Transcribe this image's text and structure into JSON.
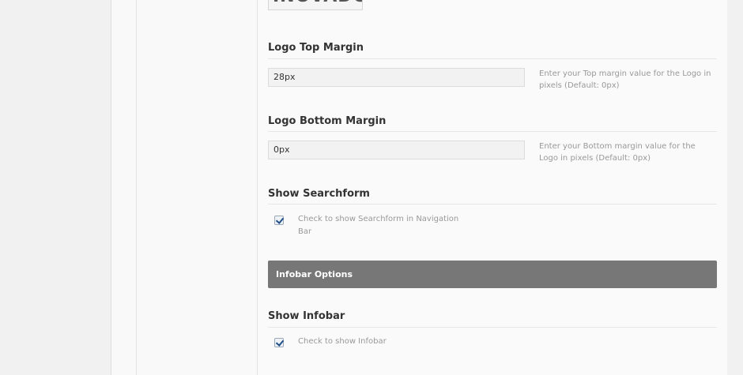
{
  "logo": {
    "preview_text": "INOVADO"
  },
  "logo_top_margin": {
    "title": "Logo Top Margin",
    "value": "28px",
    "help": "Enter your Top margin value for the Logo in pixels (Default: 0px)"
  },
  "logo_bottom_margin": {
    "title": "Logo Bottom Margin",
    "value": "0px",
    "help": "Enter your Bottom margin value for the Logo in pixels (Default: 0px)"
  },
  "show_searchform": {
    "title": "Show Searchform",
    "checked": true,
    "label": "Check to show Searchform in Navigation Bar"
  },
  "infobar_options": {
    "header": "Infobar Options"
  },
  "show_infobar": {
    "title": "Show Infobar",
    "checked": true,
    "label": "Check to show Infobar"
  },
  "colors": {
    "group_header_bg": "#777777",
    "checkbox_check": "#1f4f86"
  }
}
